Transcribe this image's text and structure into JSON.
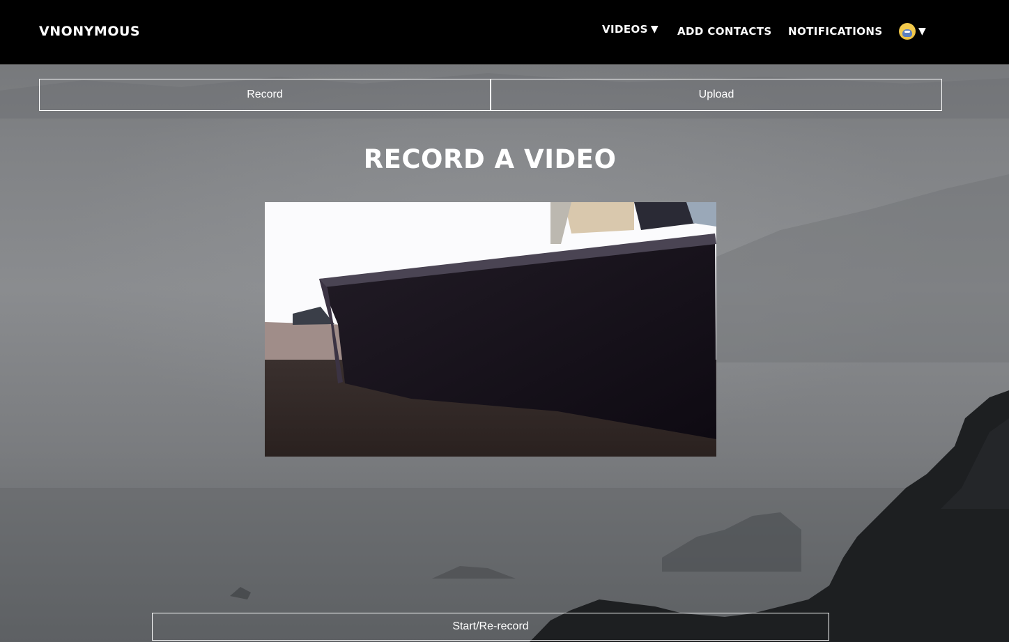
{
  "app": {
    "brand": "VNONYMOUS"
  },
  "nav": {
    "videos_label": "VIDEOS",
    "videos_caret": "▼",
    "add_contacts_label": "ADD CONTACTS",
    "notifications_label": "NOTIFICATIONS",
    "profile_caret": "▼",
    "profile_icon": "avatar-icon"
  },
  "tabs": [
    {
      "label": "Record"
    },
    {
      "label": "Upload"
    }
  ],
  "main": {
    "title": "RECORD A VIDEO",
    "start_button_label": "Start/Re-record"
  },
  "colors": {
    "navbar_bg": "#000000",
    "text": "#ffffff",
    "avatar": "#f2c94c"
  }
}
